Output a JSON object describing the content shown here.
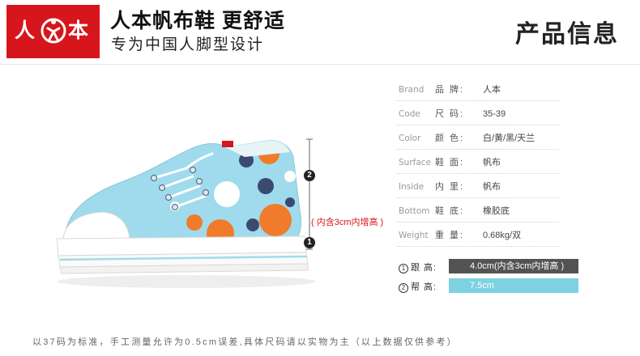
{
  "brand": {
    "logo_left_char": "人",
    "logo_right_char": "本",
    "logo_color": "#d7151d",
    "slogan": "人本帆布鞋 更舒适",
    "sub_slogan": "专为中国人脚型设计"
  },
  "section_title": "产品信息",
  "markers": {
    "top": "2",
    "bottom": "1",
    "inner_note": "( 内含3cm内增高 )"
  },
  "specs": [
    {
      "en": "Brand",
      "cn": "品  牌:",
      "value": "人本"
    },
    {
      "en": "Code",
      "cn": "尺  码:",
      "value": "35-39"
    },
    {
      "en": "Color",
      "cn": "颜  色:",
      "value": "白/黄/黑/天兰"
    },
    {
      "en": "Surface",
      "cn": "鞋  面:",
      "value": "帆布"
    },
    {
      "en": "Inside",
      "cn": "内  里:",
      "value": "帆布"
    },
    {
      "en": "Bottom",
      "cn": "鞋  底:",
      "value": "橡胶底"
    },
    {
      "en": "Weight",
      "cn": "重  量:",
      "value": "0.68kg/双"
    }
  ],
  "heights": [
    {
      "num": "1",
      "label": "跟  高:",
      "value": "4.0cm(内含3cm内增高 )",
      "color": "#535353"
    },
    {
      "num": "2",
      "label": "帮  高:",
      "value": "7.5cm",
      "color": "#7ed1e0"
    }
  ],
  "footer_note": "以37码为标准，手工测量允许为0.5cm误差,具体尺码请以实物为主（以上数据仅供参考）",
  "colors": {
    "shoe_canvas": "#9fdbec",
    "dot_orange": "#f07b2a",
    "dot_navy": "#3b4a72",
    "sole": "#ffffff"
  }
}
